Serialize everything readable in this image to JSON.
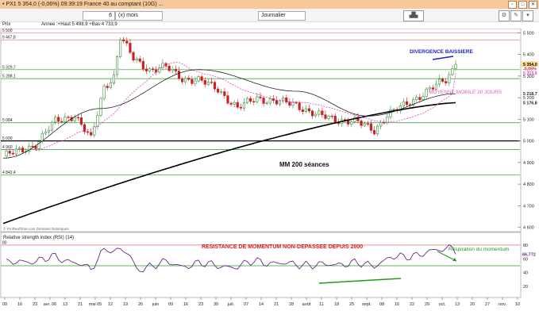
{
  "window": {
    "title": "• PX1 5 354,0 (-0,06%) 09:39:19 France 40 au comptant (10G) ...",
    "buttons": [
      "▫",
      "□",
      "✕"
    ]
  },
  "toolbar": {
    "period_value": "6",
    "period_unit": "(x) mois",
    "interval": "Journalier"
  },
  "infobar": {
    "axis_label": "Prix",
    "series_info": "Annee :+Haut 5 498,9 +Bas 4 733,9"
  },
  "colors": {
    "candle_up": "#3a8a3a",
    "candle_down": "#c82020",
    "mm200": "#000000",
    "mm50": "#222222",
    "mm20": "#e040c0",
    "rsi": "#6a2a8a",
    "annotation_green": "#1e9a1e",
    "annotation_blue": "#1b22c8",
    "annotation_red": "#e01a1a",
    "annotation_pink": "#e060c0",
    "hline_green": "#2e9a2e",
    "hline_red": "#e08080",
    "price_bg": "#ffe090"
  },
  "chart_data": [
    {
      "type": "candlestick",
      "title": "",
      "ylim": [
        4580,
        5520
      ],
      "y_ticks": [
        4600,
        4700,
        4800,
        4900,
        5000,
        5100,
        5200,
        5300,
        5400,
        5500
      ],
      "x_tick_labels": [
        "09",
        "16",
        "23",
        "avr. 06",
        "13",
        "21",
        "mai 05",
        "12",
        "19",
        "26",
        "juin",
        "09",
        "16",
        "23",
        "30",
        "juil.",
        "07",
        "14",
        "21",
        "28",
        "août",
        "11",
        "18",
        "25",
        "sept.",
        "08",
        "15",
        "22",
        "29",
        "oct.",
        "13",
        "20",
        "27",
        "nov.",
        "10"
      ],
      "close_anchors": [
        {
          "d": 0,
          "v": 4930
        },
        {
          "d": 5,
          "v": 4952
        },
        {
          "d": 10,
          "v": 4985
        },
        {
          "d": 16,
          "v": 5090
        },
        {
          "d": 22,
          "v": 5120
        },
        {
          "d": 27,
          "v": 5005
        },
        {
          "d": 31,
          "v": 5250
        },
        {
          "d": 34,
          "v": 5300
        },
        {
          "d": 36,
          "v": 5480
        },
        {
          "d": 40,
          "v": 5380
        },
        {
          "d": 45,
          "v": 5330
        },
        {
          "d": 50,
          "v": 5340
        },
        {
          "d": 55,
          "v": 5290
        },
        {
          "d": 60,
          "v": 5280
        },
        {
          "d": 66,
          "v": 5240
        },
        {
          "d": 72,
          "v": 5150
        },
        {
          "d": 78,
          "v": 5200
        },
        {
          "d": 84,
          "v": 5180
        },
        {
          "d": 90,
          "v": 5170
        },
        {
          "d": 96,
          "v": 5120
        },
        {
          "d": 102,
          "v": 5100
        },
        {
          "d": 108,
          "v": 5090
        },
        {
          "d": 114,
          "v": 5050
        },
        {
          "d": 118,
          "v": 5120
        },
        {
          "d": 124,
          "v": 5170
        },
        {
          "d": 130,
          "v": 5230
        },
        {
          "d": 136,
          "v": 5280
        },
        {
          "d": 139,
          "v": 5354
        }
      ],
      "indicators": {
        "mm200": {
          "name": "MM 200 séances",
          "start": 4618,
          "end": 5176.8
        },
        "mm50": {
          "start": 4920,
          "peak_day": 60,
          "peak": 5330,
          "trough_day": 112,
          "trough": 5115,
          "end": 5218.7
        },
        "mm20": {
          "name": "MOYENNE MOBILE 20 JOURS",
          "end": 5313.6
        }
      },
      "horizontal_levels": [
        5500,
        5467.8,
        5329.7,
        5288.1,
        5084,
        5000,
        4960,
        4842.4
      ],
      "level_labels": [
        "5 500",
        "5 467,8",
        "5 329,7",
        "5 288,1",
        "5 084",
        "5 000",
        "4 960",
        "4 842,4"
      ],
      "price_labels": {
        "last": "5 354,0",
        "change": "-0,05%",
        "mm20": "5 313,6",
        "mm50": "5 218,7",
        "mm200": "5 176,8"
      },
      "annotations": {
        "divergence": "DIVERGENCE BAISSIERE",
        "mm200": "MM 200 séances",
        "mm20": "MOYENNE MOBILE 20 JOURS",
        "source": "© ProRealTime.com Données historiques"
      }
    },
    {
      "type": "line",
      "title": "Relative strength index (RSI) (14)",
      "ylim": [
        5,
        88
      ],
      "y_ticks": [
        20,
        40,
        60,
        80
      ],
      "levels": [
        80,
        50
      ],
      "last_value": "66,772",
      "annotations": {
        "resistance": "RESISTANCE DE MOMENTUM NON-DEPASSEE DEPUIS 2000",
        "respiration": "Respiration du momentum"
      }
    }
  ]
}
